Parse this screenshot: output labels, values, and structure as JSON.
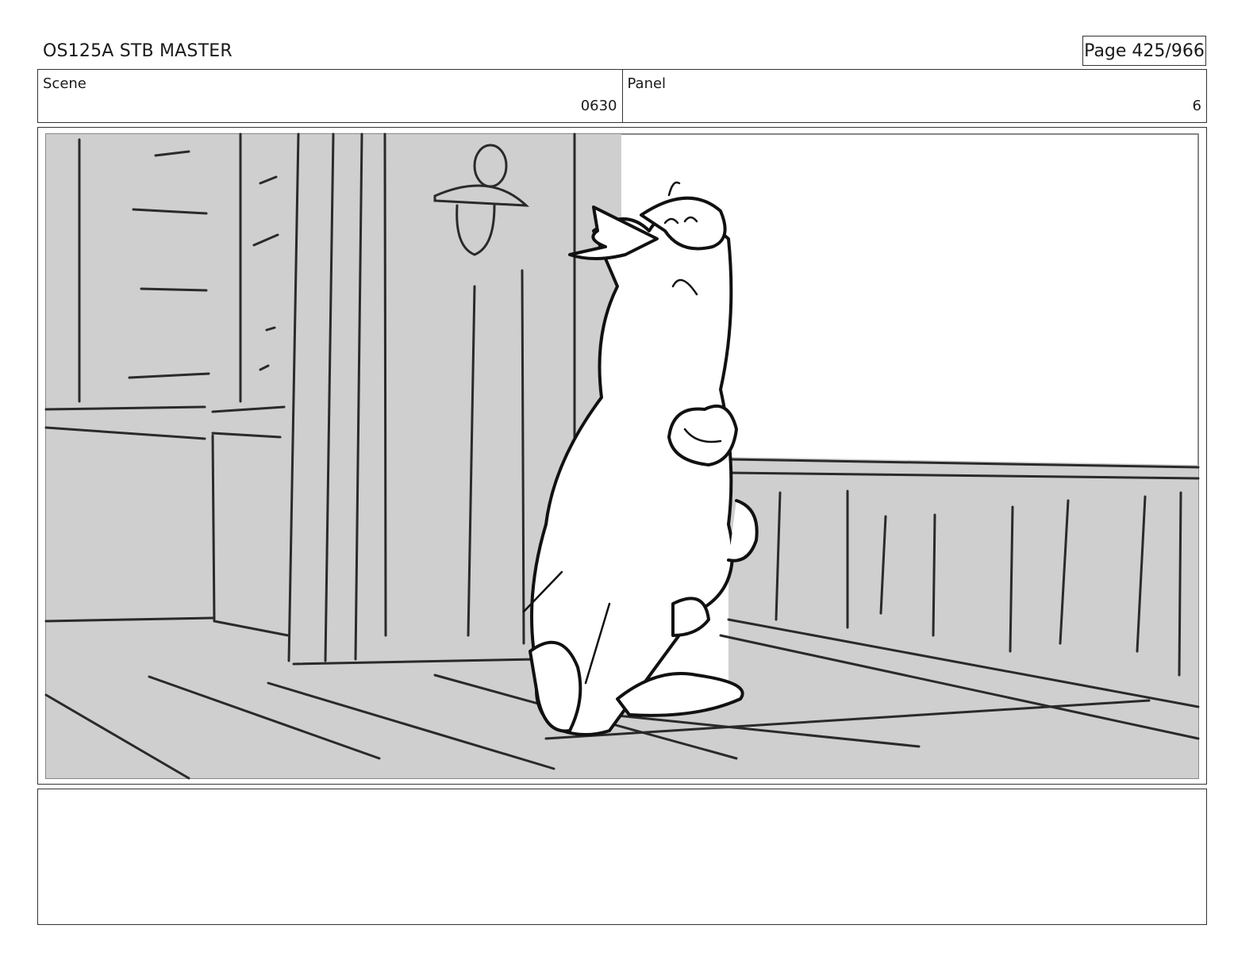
{
  "header": {
    "title": "OS125A STB MASTER",
    "page_label": "Page 425/966"
  },
  "info": {
    "scene_label": "Scene",
    "scene_value": "0630",
    "panel_label": "Panel",
    "panel_value": "6"
  },
  "colors": {
    "background_gray": "#cfcfcf",
    "line": "#2a2a2a",
    "border": "#333333"
  },
  "panel_sketch": {
    "description_icon": "storyboard-sketch-penguin-at-door"
  }
}
